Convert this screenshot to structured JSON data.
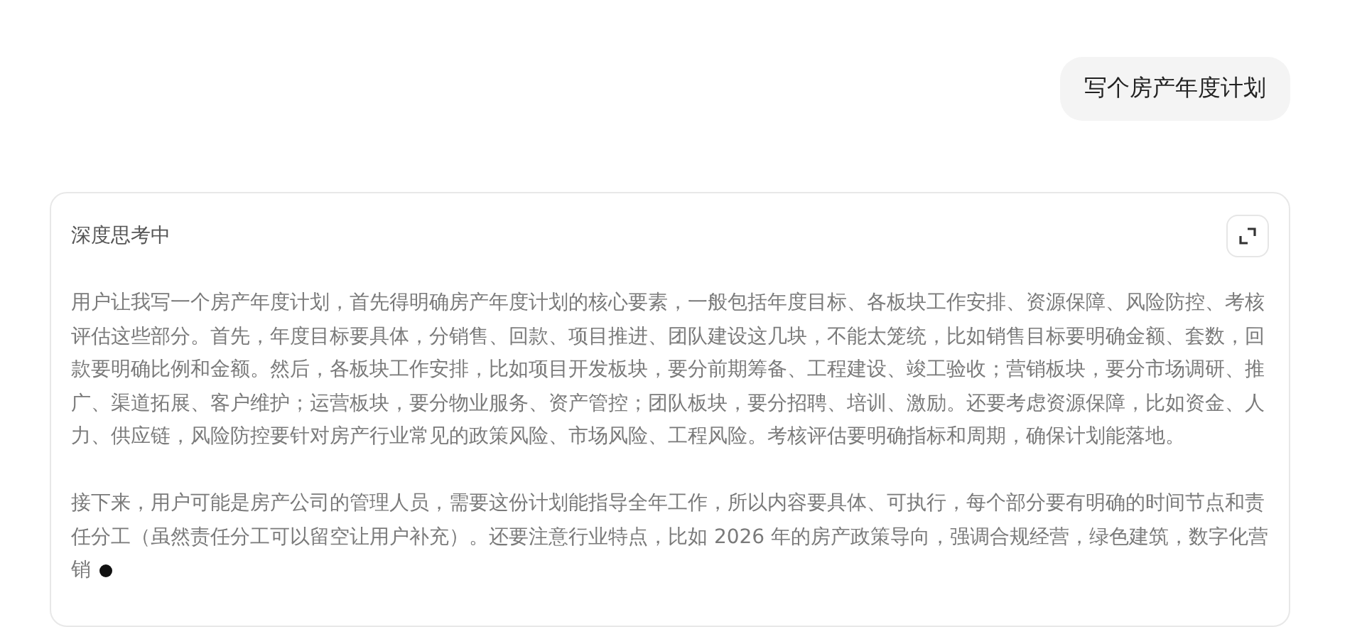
{
  "user_message": {
    "text": "写个房产年度计划"
  },
  "thinking_panel": {
    "status": "深度思考中",
    "paragraphs": [
      "用户让我写一个房产年度计划，首先得明确房产年度计划的核心要素，一般包括年度目标、各板块工作安排、资源保障、风险防控、考核评估这些部分。首先，年度目标要具体，分销售、回款、项目推进、团队建设这几块，不能太笼统，比如销售目标要明确金额、套数，回款要明确比例和金额。然后，各板块工作安排，比如项目开发板块，要分前期筹备、工程建设、竣工验收；营销板块，要分市场调研、推广、渠道拓展、客户维护；运营板块，要分物业服务、资产管控；团队板块，要分招聘、培训、激励。还要考虑资源保障，比如资金、人力、供应链，风险防控要针对房产行业常见的政策风险、市场风险、工程风险。考核评估要明确指标和周期，确保计划能落地。",
      "接下来，用户可能是房产公司的管理人员，需要这份计划能指导全年工作，所以内容要具体、可执行，每个部分要有明确的时间节点和责任分工（虽然责任分工可以留空让用户补充）。还要注意行业特点，比如 2026 年的房产政策导向，强调合规经营，绿色建筑，数字化营销"
    ],
    "streaming": true
  }
}
